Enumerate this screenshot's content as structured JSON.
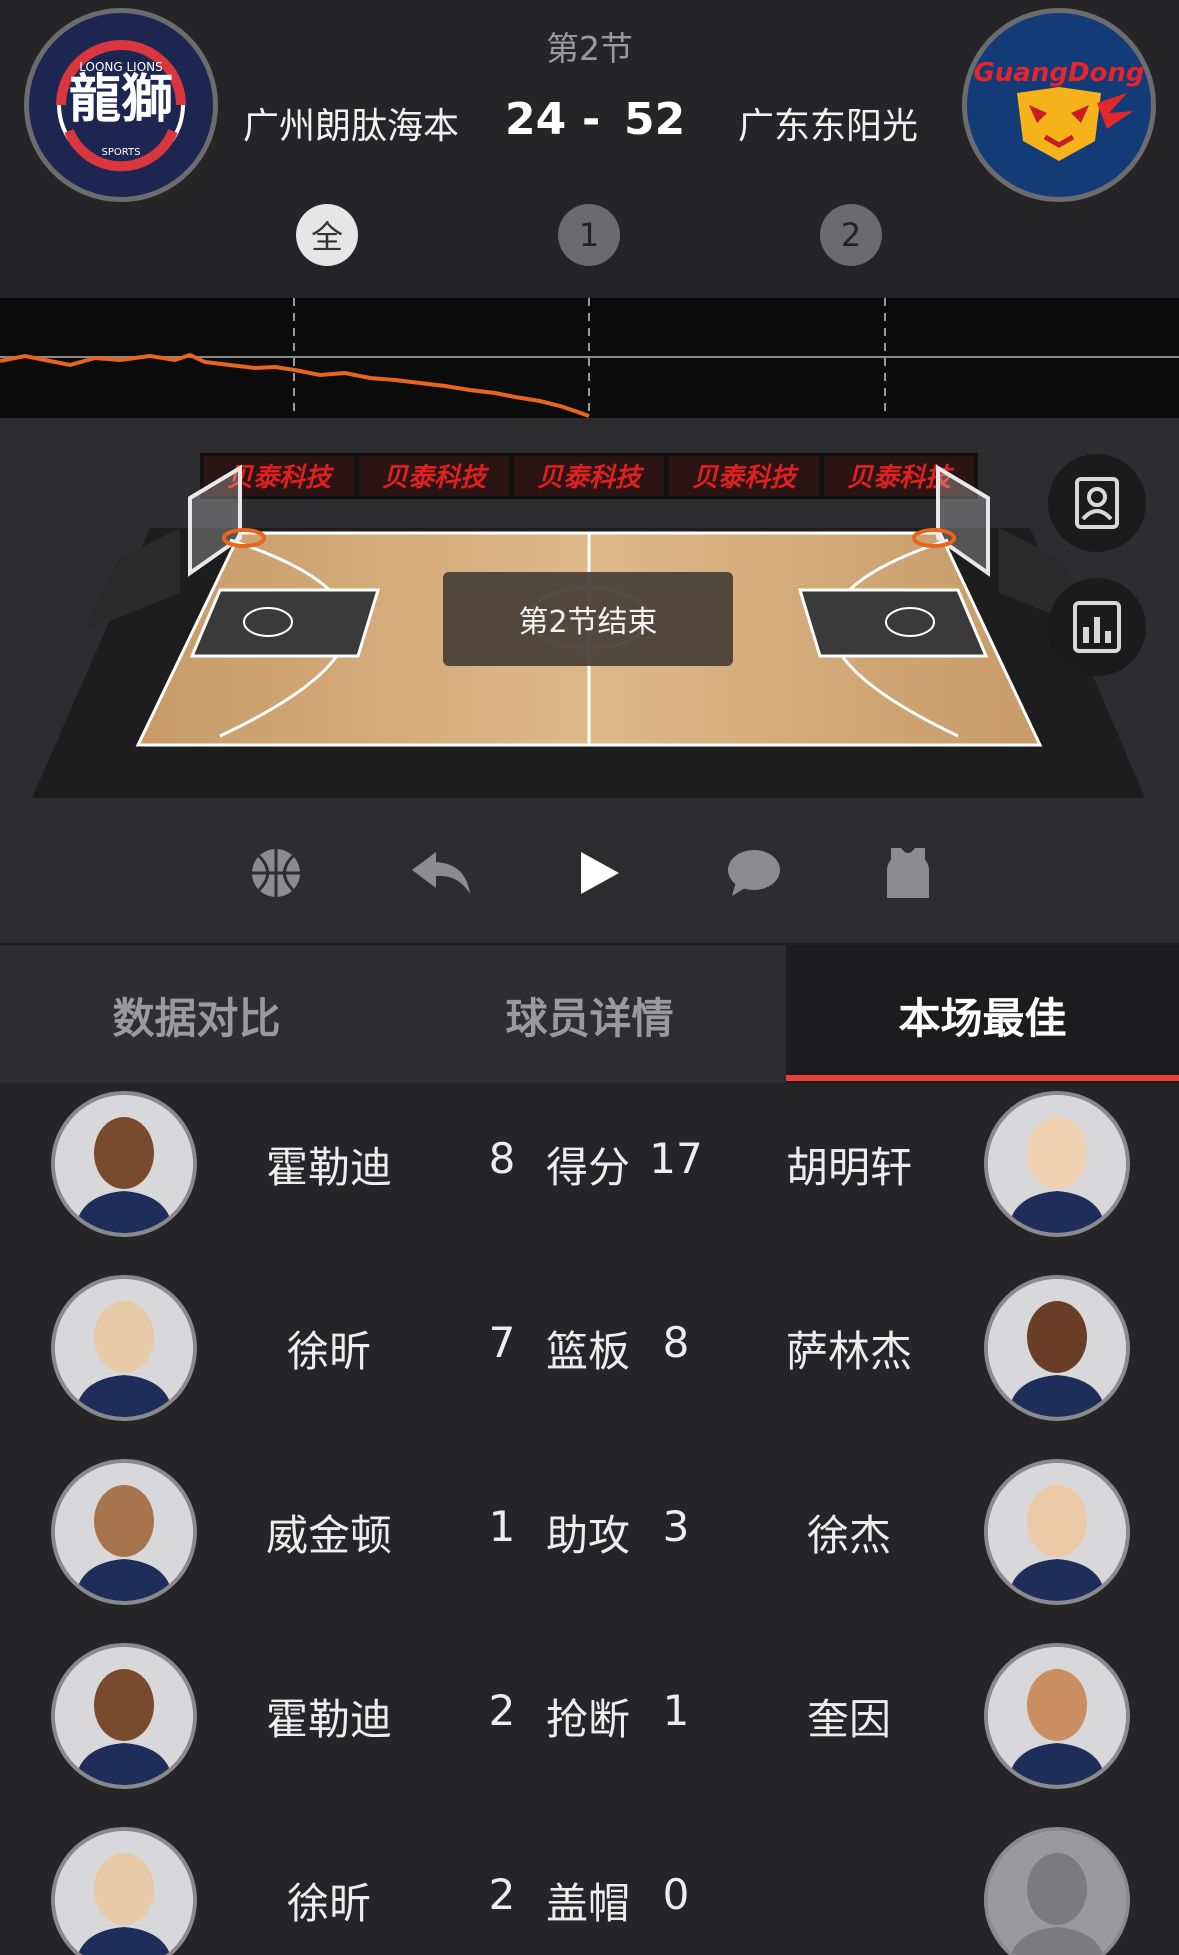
{
  "header": {
    "period_title": "第2节",
    "home_team": "广州朗肽海本",
    "away_team": "广东东阳光",
    "home_score": "24",
    "score_sep": "-",
    "away_score": "52",
    "home_logo_text": "LOONG LIONS",
    "away_logo_text": "GuangDong",
    "period_tabs": [
      "全",
      "1",
      "2"
    ],
    "active_period_tab": "全"
  },
  "court": {
    "ad_text": "贝泰科技",
    "status_text": "第2节结束"
  },
  "side_buttons": [
    "lineup-icon",
    "stats-chart-icon"
  ],
  "controls": [
    "basketball-icon",
    "undo-arrow-icon",
    "play-icon",
    "comment-icon",
    "jersey-icon"
  ],
  "tabs": {
    "items": [
      "数据对比",
      "球员详情",
      "本场最佳"
    ],
    "active": "本场最佳"
  },
  "best": [
    {
      "left_player": "霍勒迪",
      "left_value": "8",
      "stat": "得分",
      "right_value": "17",
      "right_player": "胡明轩"
    },
    {
      "left_player": "徐昕",
      "left_value": "7",
      "stat": "篮板",
      "right_value": "8",
      "right_player": "萨林杰"
    },
    {
      "left_player": "威金顿",
      "left_value": "1",
      "stat": "助攻",
      "right_value": "3",
      "right_player": "徐杰"
    },
    {
      "left_player": "霍勒迪",
      "left_value": "2",
      "stat": "抢断",
      "right_value": "1",
      "right_player": "奎因"
    },
    {
      "left_player": "徐昕",
      "left_value": "2",
      "stat": "盖帽",
      "right_value": "0",
      "right_player": ""
    }
  ],
  "colors": {
    "accent": "#e8413c",
    "trend_line": "#e8651e",
    "background": "#252527"
  }
}
